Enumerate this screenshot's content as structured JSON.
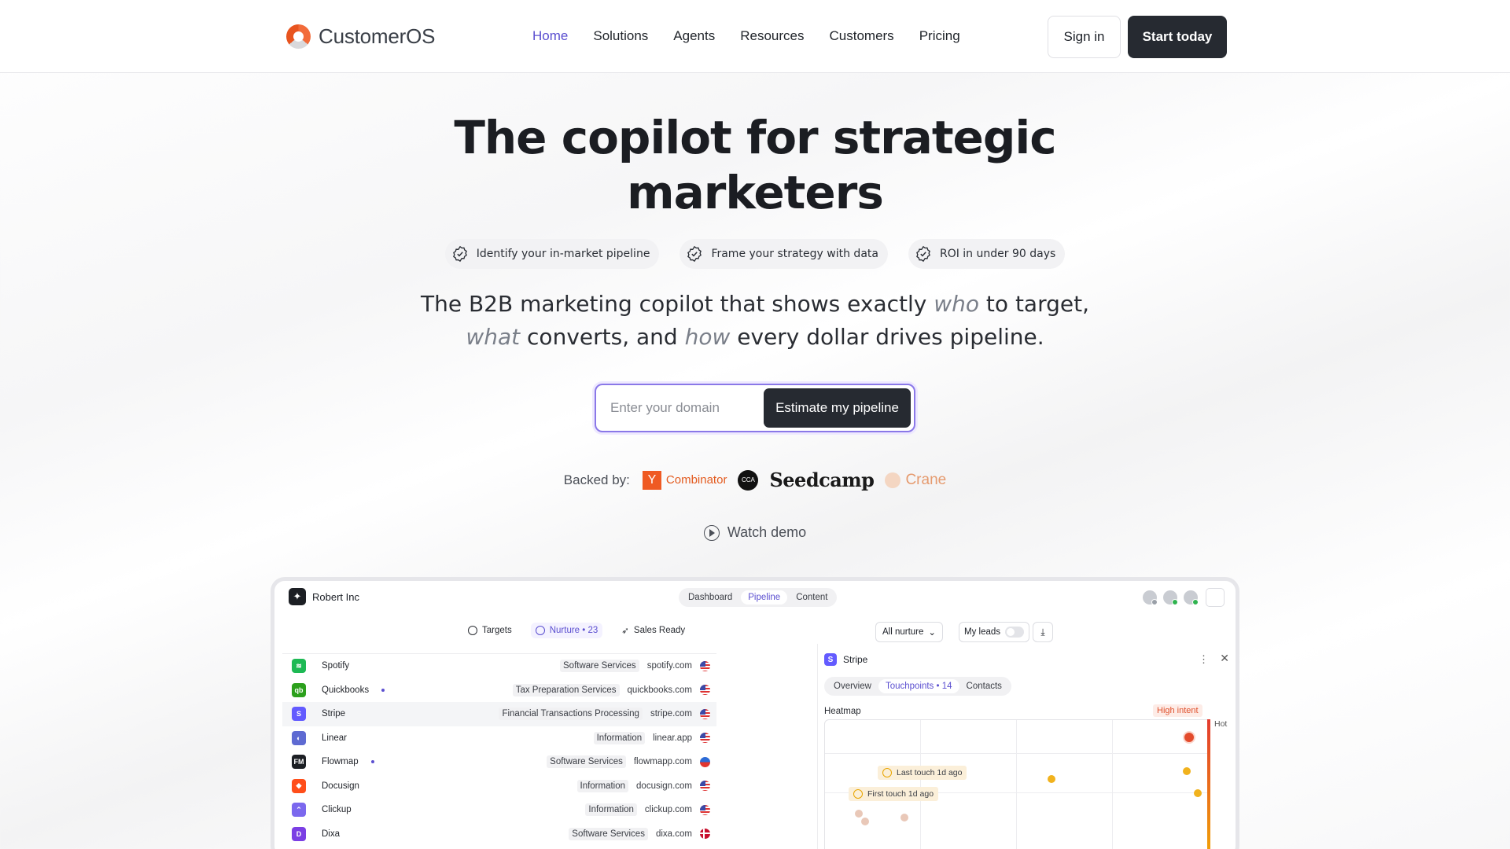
{
  "nav": {
    "logo_text": "CustomerOS",
    "items": [
      {
        "label": "Home",
        "active": true
      },
      {
        "label": "Solutions",
        "active": false
      },
      {
        "label": "Agents",
        "active": false
      },
      {
        "label": "Resources",
        "active": false
      },
      {
        "label": "Customers",
        "active": false
      },
      {
        "label": "Pricing",
        "active": false
      }
    ],
    "signin_label": "Sign in",
    "start_label": "Start today"
  },
  "hero": {
    "title": "The copilot for strategic marketers",
    "chips": [
      "Identify your in-market pipeline",
      "Frame your strategy with data",
      "ROI in under 90 days"
    ],
    "subtitle": {
      "p1": "The B2B marketing copilot that shows exactly ",
      "who": "who",
      "p2": " to target, ",
      "what": "what",
      "p3": " converts, and ",
      "how": "how",
      "p4": " every dollar drives pipeline."
    },
    "domain_placeholder": "Enter your domain",
    "cta_label": "Estimate my pipeline",
    "backed_label": "Backed by:",
    "backers": {
      "yc_letter": "Y",
      "yc_name": "Combinator",
      "cc_text": "CCA",
      "seedcamp": "Seedcamp",
      "crane": "Crane"
    },
    "watch_demo": "Watch demo"
  },
  "app": {
    "workspace": "Robert Inc",
    "tabs": [
      {
        "label": "Dashboard",
        "active": false
      },
      {
        "label": "Pipeline",
        "active": true
      },
      {
        "label": "Content",
        "active": false
      }
    ],
    "filters": {
      "targets": "Targets",
      "nurture": "Nurture • 23",
      "sales_ready": "Sales Ready",
      "select": "All nurture",
      "my_leads": "My leads"
    },
    "companies": [
      {
        "name": "Spotify",
        "category": "Software Services",
        "domain": "spotify.com",
        "color": "#1db954",
        "icon": "≋",
        "dot": false,
        "flag": "us"
      },
      {
        "name": "Quickbooks",
        "category": "Tax Preparation Services",
        "domain": "quickbooks.com",
        "color": "#2ca01c",
        "icon": "qb",
        "dot": true,
        "flag": "us"
      },
      {
        "name": "Stripe",
        "category": "Financial Transactions Processing",
        "domain": "stripe.com",
        "color": "#635bff",
        "icon": "S",
        "dot": false,
        "flag": "us"
      },
      {
        "name": "Linear",
        "category": "Information",
        "domain": "linear.app",
        "color": "#5e6ad2",
        "icon": "◐",
        "dot": false,
        "flag": "us"
      },
      {
        "name": "Flowmap",
        "category": "Software Services",
        "domain": "flowmapp.com",
        "color": "#1c1f24",
        "icon": "FM",
        "dot": true,
        "flag": "ch"
      },
      {
        "name": "Docusign",
        "category": "Information",
        "domain": "docusign.com",
        "color": "#ff4e1a",
        "icon": "◆",
        "dot": false,
        "flag": "us"
      },
      {
        "name": "Clickup",
        "category": "Information",
        "domain": "clickup.com",
        "color": "#7b68ee",
        "icon": "⌃",
        "dot": false,
        "flag": "us"
      },
      {
        "name": "Dixa",
        "category": "Software Services",
        "domain": "dixa.com",
        "color": "#7b3fe4",
        "icon": "D",
        "dot": false,
        "flag": "dk"
      }
    ],
    "panel": {
      "company": "Stripe",
      "tabs": [
        {
          "label": "Overview",
          "active": false
        },
        {
          "label": "Touchpoints • 14",
          "active": true
        },
        {
          "label": "Contacts",
          "active": false
        }
      ],
      "heatmap_label": "Heatmap",
      "intent_badge": "High intent",
      "hot_label": "Hot",
      "last_touch": "Last touch 1d ago",
      "first_touch": "First touch 1d ago"
    }
  },
  "colors": {
    "accent": "#5b4fd0",
    "dark": "#262a31",
    "hot": "#e34b2c",
    "warm": "#f1b21d"
  }
}
